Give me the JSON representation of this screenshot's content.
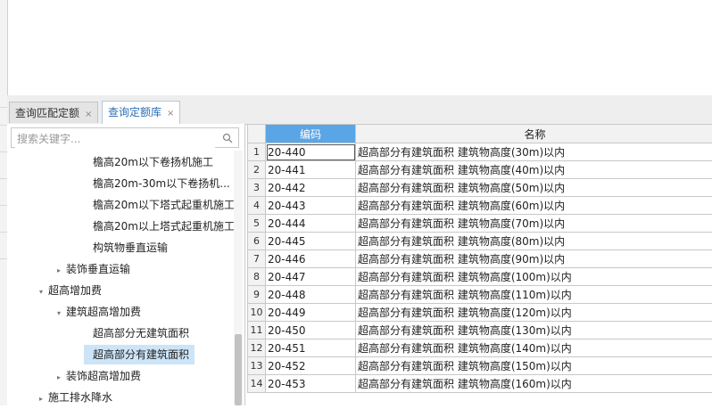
{
  "tabs": [
    {
      "label": "查询匹配定额",
      "close": "×",
      "active": false
    },
    {
      "label": "查询定额库",
      "close": "×",
      "active": true
    }
  ],
  "search": {
    "placeholder": "搜索关键字..."
  },
  "tree": [
    {
      "label": "檐高20m以下卷扬机施工",
      "arrow": "",
      "level": 3
    },
    {
      "label": "檐高20m-30m以下卷扬机...",
      "arrow": "",
      "level": 3
    },
    {
      "label": "檐高20m以下塔式起重机施工",
      "arrow": "",
      "level": 3
    },
    {
      "label": "檐高20m以上塔式起重机施工",
      "arrow": "",
      "level": 3
    },
    {
      "label": "构筑物垂直运输",
      "arrow": "",
      "level": 3
    },
    {
      "label": "装饰垂直运输",
      "arrow": "▸",
      "level": 2
    },
    {
      "label": "超高增加费",
      "arrow": "▾",
      "level": 1
    },
    {
      "label": "建筑超高增加费",
      "arrow": "▾",
      "level": 2
    },
    {
      "label": "超高部分无建筑面积",
      "arrow": "",
      "level": 3
    },
    {
      "label": "超高部分有建筑面积",
      "arrow": "",
      "level": 3,
      "selected": true
    },
    {
      "label": "装饰超高增加费",
      "arrow": "▸",
      "level": 2
    },
    {
      "label": "施工排水降水",
      "arrow": "▸",
      "level": 1
    }
  ],
  "grid": {
    "columns": [
      "",
      "编码",
      "名称"
    ],
    "rows": [
      {
        "num": "1",
        "code": "20-440",
        "name": "超高部分有建筑面积 建筑物高度(30m)以内"
      },
      {
        "num": "2",
        "code": "20-441",
        "name": "超高部分有建筑面积 建筑物高度(40m)以内"
      },
      {
        "num": "3",
        "code": "20-442",
        "name": "超高部分有建筑面积 建筑物高度(50m)以内"
      },
      {
        "num": "4",
        "code": "20-443",
        "name": "超高部分有建筑面积 建筑物高度(60m)以内"
      },
      {
        "num": "5",
        "code": "20-444",
        "name": "超高部分有建筑面积 建筑物高度(70m)以内"
      },
      {
        "num": "6",
        "code": "20-445",
        "name": "超高部分有建筑面积 建筑物高度(80m)以内"
      },
      {
        "num": "7",
        "code": "20-446",
        "name": "超高部分有建筑面积 建筑物高度(90m)以内"
      },
      {
        "num": "8",
        "code": "20-447",
        "name": "超高部分有建筑面积 建筑物高度(100m)以内"
      },
      {
        "num": "9",
        "code": "20-448",
        "name": "超高部分有建筑面积 建筑物高度(110m)以内"
      },
      {
        "num": "10",
        "code": "20-449",
        "name": "超高部分有建筑面积 建筑物高度(120m)以内"
      },
      {
        "num": "11",
        "code": "20-450",
        "name": "超高部分有建筑面积 建筑物高度(130m)以内"
      },
      {
        "num": "12",
        "code": "20-451",
        "name": "超高部分有建筑面积 建筑物高度(140m)以内"
      },
      {
        "num": "13",
        "code": "20-452",
        "name": "超高部分有建筑面积 建筑物高度(150m)以内"
      },
      {
        "num": "14",
        "code": "20-453",
        "name": "超高部分有建筑面积 建筑物高度(160m)以内"
      }
    ]
  },
  "colors": {
    "accent": "#5aa5e6",
    "selected": "#cce4f7",
    "active_tab_text": "#2a6fb8"
  }
}
